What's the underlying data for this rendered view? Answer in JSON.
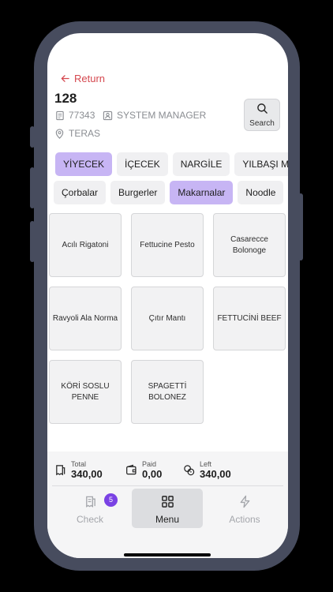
{
  "header": {
    "return_label": "Return",
    "title": "128",
    "order_no": "77343",
    "user": "SYSTEM MANAGER",
    "area": "TERAS",
    "search_label": "Search"
  },
  "categories": [
    "YİYECEK",
    "İÇECEK",
    "NARGİLE",
    "YILBAŞI MENÜ"
  ],
  "subcategories": [
    "Çorbalar",
    "Burgerler",
    "Makarnalar",
    "Noodle"
  ],
  "active_category": "YİYECEK",
  "active_subcategory": "Makarnalar",
  "products": [
    "Acılı Rigatoni",
    "Fettucine Pesto",
    "Casarecce Bolonoge",
    "Ravyoli Ala Norma",
    "Çıtır Mantı",
    "FETTUCİNİ BEEF",
    "KÖRİ SOSLU PENNE",
    "SPAGETTİ BOLONEZ"
  ],
  "summary": {
    "total_label": "Total",
    "total_value": "340,00",
    "paid_label": "Paid",
    "paid_value": "0,00",
    "left_label": "Left",
    "left_value": "340,00"
  },
  "nav": {
    "check_label": "Check",
    "check_badge": "5",
    "menu_label": "Menu",
    "actions_label": "Actions"
  },
  "colors": {
    "accent": "#c7b5f4",
    "return": "#d5484f",
    "badge": "#7a42e4",
    "frame": "#474c5e"
  }
}
